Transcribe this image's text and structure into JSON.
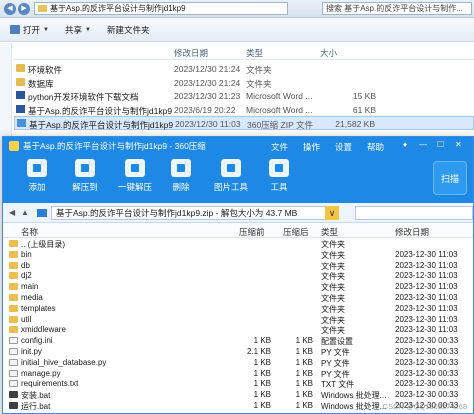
{
  "explorer": {
    "path": "基于Asp.的反诈平台设计与制作jd1kp9",
    "search_placeholder": "搜索 基于Asp.的反诈平台设计与制作...",
    "toolbar": {
      "open": "打开",
      "share": "共享",
      "new_folder": "新建文件夹"
    },
    "columns": {
      "date": "修改日期",
      "type": "类型",
      "size": "大小"
    },
    "rows": [
      {
        "name": "环境软件",
        "date": "2023/12/30 21:24",
        "type": "文件夹",
        "size": "",
        "kind": "folder"
      },
      {
        "name": "数据库",
        "date": "2023/12/30 21:24",
        "type": "文件夹",
        "size": "",
        "kind": "folder"
      },
      {
        "name": "python开发环境软件下载文档",
        "date": "2023/12/30 21:23",
        "type": "Microsoft Word ...",
        "size": "15 KB",
        "kind": "doc"
      },
      {
        "name": "基于Asp.的反诈平台设计与制作jd1kp9",
        "date": "2023/6/19 20:22",
        "type": "Microsoft Word ...",
        "size": "61 KB",
        "kind": "doc"
      },
      {
        "name": "基于Asp.的反诈平台设计与制作jd1kp9",
        "date": "2023/12/30 11:03",
        "type": "360压缩 ZIP 文件",
        "size": "21,582 KB",
        "kind": "zip",
        "selected": true
      }
    ]
  },
  "zip": {
    "title": "基于Asp.的反诈平台设计与制作jd1kp9 - 360压缩",
    "menu": [
      "文件",
      "操作",
      "设置",
      "帮助"
    ],
    "tools": [
      "添加",
      "解压到",
      "一键解压",
      "删除",
      "图片工具",
      "工具"
    ],
    "scan_label": "扫描",
    "address": "基于Asp.的反诈平台设计与制作jd1kp9.zip - 解包大小为 43.7 MB",
    "columns": {
      "name": "名称",
      "size": "压缩前",
      "packed": "压缩后",
      "type": "类型",
      "date": "修改日期"
    },
    "rows": [
      {
        "name": ".. (上级目录)",
        "size": "",
        "packed": "",
        "type": "文件夹",
        "date": "",
        "kind": "up"
      },
      {
        "name": "bin",
        "size": "",
        "packed": "",
        "type": "文件夹",
        "date": "2023-12-30 11:03",
        "kind": "folder"
      },
      {
        "name": "db",
        "size": "",
        "packed": "",
        "type": "文件夹",
        "date": "2023-12-30 11:03",
        "kind": "folder"
      },
      {
        "name": "dj2",
        "size": "",
        "packed": "",
        "type": "文件夹",
        "date": "2023-12-30 11:03",
        "kind": "folder"
      },
      {
        "name": "main",
        "size": "",
        "packed": "",
        "type": "文件夹",
        "date": "2023-12-30 11:03",
        "kind": "folder"
      },
      {
        "name": "media",
        "size": "",
        "packed": "",
        "type": "文件夹",
        "date": "2023-12-30 11:03",
        "kind": "folder"
      },
      {
        "name": "templates",
        "size": "",
        "packed": "",
        "type": "文件夹",
        "date": "2023-12-30 11:03",
        "kind": "folder"
      },
      {
        "name": "util",
        "size": "",
        "packed": "",
        "type": "文件夹",
        "date": "2023-12-30 11:03",
        "kind": "folder"
      },
      {
        "name": "xmiddleware",
        "size": "",
        "packed": "",
        "type": "文件夹",
        "date": "2023-12-30 11:03",
        "kind": "folder"
      },
      {
        "name": "config.ini",
        "size": "1 KB",
        "packed": "1 KB",
        "type": "配置设置",
        "date": "2023-12-30 00:33",
        "kind": "file"
      },
      {
        "name": "init.py",
        "size": "2.1 KB",
        "packed": "1 KB",
        "type": "PY 文件",
        "date": "2023-12-30 00:33",
        "kind": "file"
      },
      {
        "name": "initial_hive_database.py",
        "size": "1 KB",
        "packed": "1 KB",
        "type": "PY 文件",
        "date": "2023-12-30 00:33",
        "kind": "file"
      },
      {
        "name": "manage.py",
        "size": "1 KB",
        "packed": "1 KB",
        "type": "PY 文件",
        "date": "2023-12-30 00:33",
        "kind": "file"
      },
      {
        "name": "requirements.txt",
        "size": "1 KB",
        "packed": "1 KB",
        "type": "TXT 文件",
        "date": "2023-12-30 00:33",
        "kind": "file"
      },
      {
        "name": "安装.bat",
        "size": "1 KB",
        "packed": "1 KB",
        "type": "Windows 批处理...",
        "date": "2023-12-30 00:33",
        "kind": "bat"
      },
      {
        "name": "运行.bat",
        "size": "1 KB",
        "packed": "1 KB",
        "type": "Windows 批处理...",
        "date": "2023-12-30 00:33",
        "kind": "bat"
      }
    ]
  },
  "watermark": "CSDN @QQ1302274268"
}
